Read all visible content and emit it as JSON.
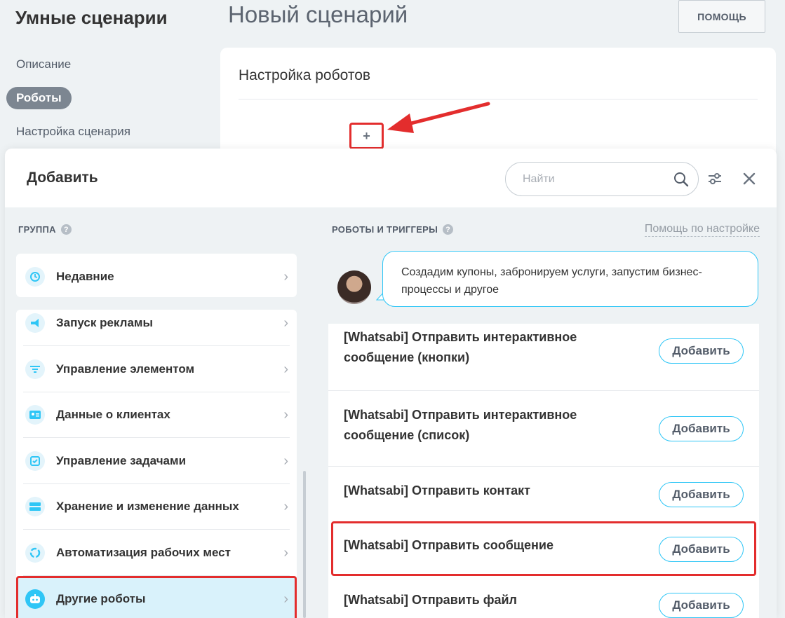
{
  "app": {
    "title": "Умные сценарии",
    "page_title": "Новый сценарий",
    "help_button": "ПОМОЩЬ"
  },
  "left_nav": {
    "items": [
      {
        "label": "Описание",
        "active": false
      },
      {
        "label": "Роботы",
        "active": true
      },
      {
        "label": "Настройка сценария",
        "active": false
      }
    ]
  },
  "settings_card": {
    "title": "Настройка роботов",
    "add_symbol": "+"
  },
  "slider": {
    "title": "Добавить",
    "search_placeholder": "Найти",
    "group_label": "ГРУППА",
    "robots_label": "РОБОТЫ И ТРИГГЕРЫ",
    "help_link": "Помощь по настройке",
    "question_mark": "?",
    "chevron": "›",
    "bubble_text": "Создадим купоны, забронируем услуги, запустим бизнес-процессы и другое",
    "recent": {
      "label": "Недавние",
      "icon": "history-icon"
    },
    "groups": [
      {
        "label": "Запуск рекламы",
        "icon": "megaphone-icon",
        "selected": false
      },
      {
        "label": "Управление элементом",
        "icon": "funnel-icon",
        "selected": false
      },
      {
        "label": "Данные о клиентах",
        "icon": "contact-card-icon",
        "selected": false
      },
      {
        "label": "Управление задачами",
        "icon": "task-check-icon",
        "selected": false
      },
      {
        "label": "Хранение и изменение данных",
        "icon": "storage-icon",
        "selected": false
      },
      {
        "label": "Автоматизация рабочих мест",
        "icon": "cycle-icon",
        "selected": false
      },
      {
        "label": "Другие роботы",
        "icon": "robot-icon",
        "selected": true
      }
    ],
    "robots": [
      {
        "title": "[Whatsabi] Отправить интерактивное сообщение (кнопки)",
        "button": "Добавить",
        "highlighted": false
      },
      {
        "title": "[Whatsabi] Отправить интерактивное сообщение (список)",
        "button": "Добавить",
        "highlighted": false
      },
      {
        "title": "[Whatsabi] Отправить контакт",
        "button": "Добавить",
        "highlighted": false
      },
      {
        "title": "[Whatsabi] Отправить сообщение",
        "button": "Добавить",
        "highlighted": true
      },
      {
        "title": "[Whatsabi] Отправить файл",
        "button": "Добавить",
        "highlighted": false
      }
    ]
  },
  "colors": {
    "accent": "#2fc6f6",
    "highlight": "#e32d2d",
    "nav_active_bg": "#7c8691"
  }
}
